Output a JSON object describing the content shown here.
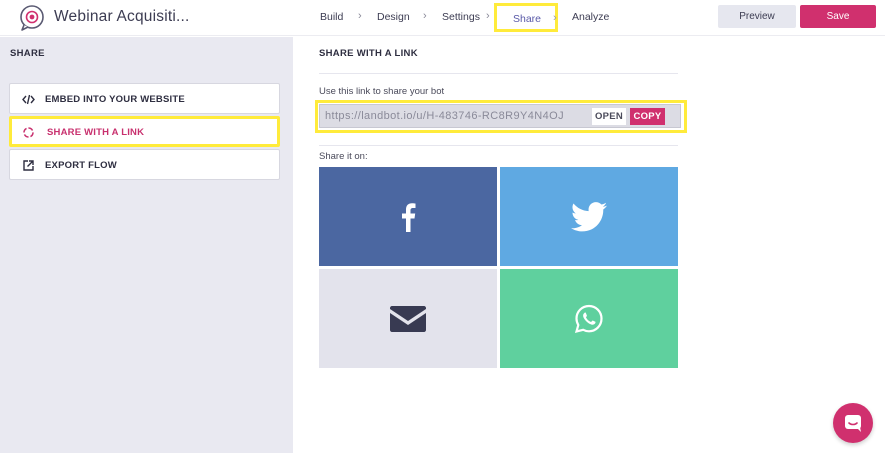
{
  "header": {
    "app_title": "Webinar Acquisiti...",
    "nav": [
      {
        "label": "Build"
      },
      {
        "label": "Design"
      },
      {
        "label": "Settings"
      },
      {
        "label": "Share"
      },
      {
        "label": "Analyze"
      }
    ],
    "nav_sep": "›",
    "preview_label": "Preview",
    "save_label": "Save"
  },
  "sidebar": {
    "title": "SHARE",
    "items": [
      {
        "label": "EMBED INTO YOUR WEBSITE",
        "icon": "code-icon"
      },
      {
        "label": "SHARE WITH A LINK",
        "icon": "link-circle-icon"
      },
      {
        "label": "EXPORT FLOW",
        "icon": "external-link-icon"
      }
    ]
  },
  "main": {
    "title": "SHARE WITH A LINK",
    "link_label": "Use this link to share your bot",
    "link_value": "https://landbot.io/u/H-483746-RC8R9Y4N4OJ",
    "open_label": "OPEN",
    "copy_label": "COPY",
    "share_on_label": "Share it on:",
    "tiles": [
      {
        "icon": "facebook-icon",
        "color": "#4b67a1"
      },
      {
        "icon": "twitter-icon",
        "color": "#5fa9e2"
      },
      {
        "icon": "email-icon",
        "color": "#e3e3ec"
      },
      {
        "icon": "whatsapp-icon",
        "color": "#5fd09e"
      }
    ]
  },
  "colors": {
    "accent": "#d0306e",
    "highlight": "#ffeb3b",
    "sidebar_bg": "#e9e9f1"
  }
}
